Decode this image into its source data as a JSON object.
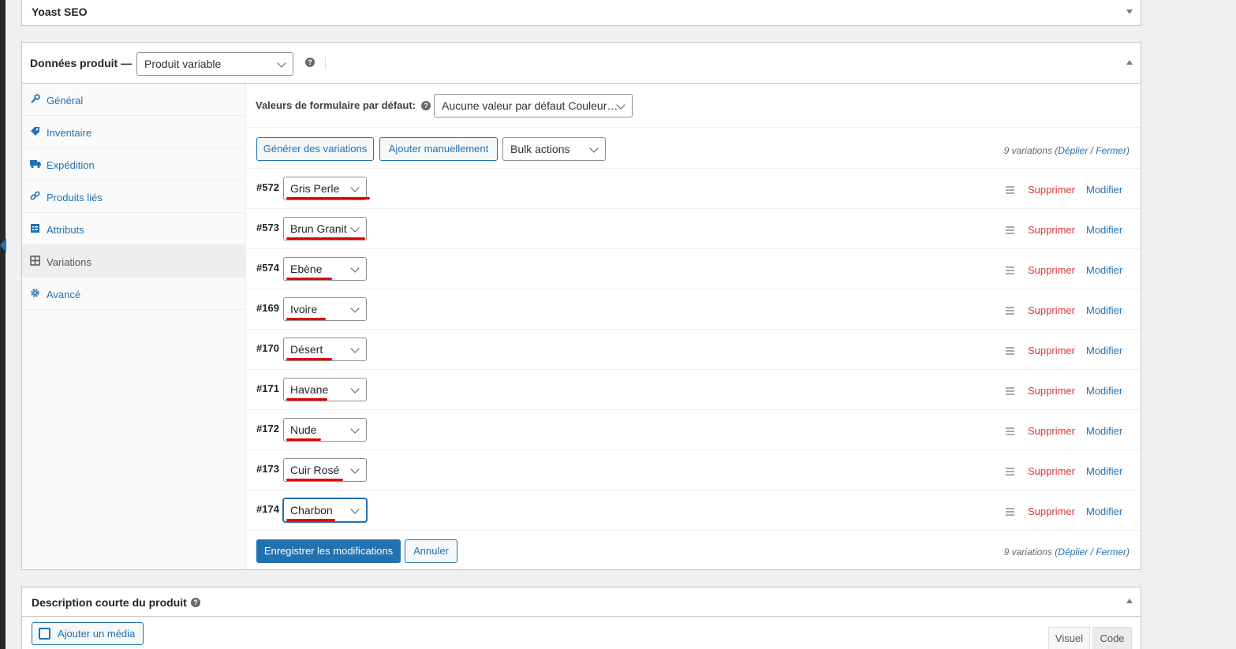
{
  "yoast": {
    "title": "Yoast SEO"
  },
  "product_data": {
    "title": "Données produit —",
    "type_select": "Produit variable",
    "help": "?"
  },
  "tabs": [
    {
      "label": "Général",
      "icon": "wrench-icon"
    },
    {
      "label": "Inventaire",
      "icon": "tag-icon"
    },
    {
      "label": "Expédition",
      "icon": "truck-icon"
    },
    {
      "label": "Produits liés",
      "icon": "link-icon"
    },
    {
      "label": "Attributs",
      "icon": "list-icon"
    },
    {
      "label": "Variations",
      "icon": "grid-icon",
      "active": true
    },
    {
      "label": "Avancé",
      "icon": "gear-icon"
    }
  ],
  "defaults": {
    "label": "Valeurs de formulaire par défaut:",
    "select_value": "Aucune valeur par défaut Couleur…"
  },
  "toolbar": {
    "generate_label": "Générer des variations",
    "add_manual_label": "Ajouter manuellement",
    "bulk_actions": "Bulk actions"
  },
  "count_note": {
    "text": "9 variations (",
    "expand": "Déplier",
    "sep": " / ",
    "close": "Fermer",
    "end": ")"
  },
  "variations": [
    {
      "id": "#572",
      "value": "Gris Perle"
    },
    {
      "id": "#573",
      "value": "Brun Granit"
    },
    {
      "id": "#574",
      "value": "Ebène"
    },
    {
      "id": "#169",
      "value": "Ivoire"
    },
    {
      "id": "#170",
      "value": "Désert"
    },
    {
      "id": "#171",
      "value": "Havane"
    },
    {
      "id": "#172",
      "value": "Nude"
    },
    {
      "id": "#173",
      "value": "Cuir Rosé"
    },
    {
      "id": "#174",
      "value": "Charbon",
      "focused": true
    }
  ],
  "row_actions": {
    "delete": "Supprimer",
    "edit": "Modifier"
  },
  "footer": {
    "save_label": "Enregistrer les modifications",
    "cancel_label": "Annuler"
  },
  "description": {
    "title": "Description courte du produit",
    "add_media": "Ajouter un média",
    "tab_visual": "Visuel",
    "tab_code": "Code"
  },
  "colors": {
    "accent": "#2271b1",
    "delete": "#d63638",
    "annotation": "#e00000"
  }
}
